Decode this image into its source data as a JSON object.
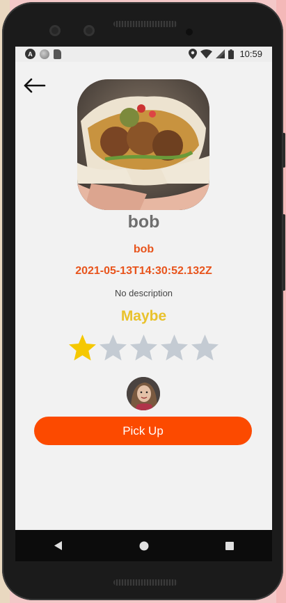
{
  "status_bar": {
    "time": "10:59",
    "left_icons": [
      "app-a-icon",
      "app-circle-icon",
      "sd-card-icon"
    ],
    "right_icons": [
      "location-icon",
      "wifi-icon",
      "signal-icon",
      "battery-icon"
    ],
    "app_a_letter": "A"
  },
  "item": {
    "title": "bob",
    "user": "bob",
    "date": "2021-05-13T14:30:52.132Z",
    "description": "No description",
    "rating_label": "Maybe",
    "rating": 1,
    "rating_max": 5
  },
  "actions": {
    "pickup_label": "Pick Up"
  },
  "colors": {
    "accent": "#fc4a00",
    "text_orange": "#e8541c",
    "star_filled": "#f5c800",
    "star_empty": "#c4cbd3",
    "rating_label": "#e9c22c"
  },
  "nav": {
    "buttons": [
      "back-triangle-icon",
      "home-circle-icon",
      "recents-square-icon"
    ]
  }
}
